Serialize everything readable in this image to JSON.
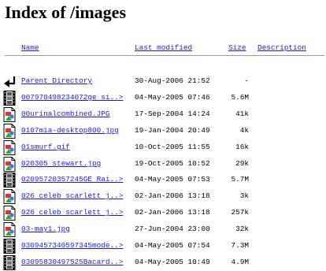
{
  "title": "Index of /images",
  "columns": {
    "name": "Name",
    "last_modified": "Last modified",
    "size": "Size",
    "description": "Description"
  },
  "entries": [
    {
      "name": "Parent Directory",
      "modified": "30-Aug-2006 21:52",
      "size": "-",
      "icon": "back-arrow-icon"
    },
    {
      "name": "007970498234072ge si..>",
      "modified": "04-May-2005 07:46",
      "size": "5.6M",
      "icon": "movie-file-icon"
    },
    {
      "name": "00urinalcombined.JPG",
      "modified": "17-Sep-2004 14:24",
      "size": "41k",
      "icon": "image-file-icon"
    },
    {
      "name": "0107mia-desktop800.jpg",
      "modified": "19-Jan-2004 20:49",
      "size": "4k",
      "icon": "image-file-icon"
    },
    {
      "name": "01smurf.gif",
      "modified": "10-Oct-2005 11:55",
      "size": "16k",
      "icon": "image-file-icon"
    },
    {
      "name": "020305 stewart.jpg",
      "modified": "19-Oct-2005 10:52",
      "size": "29k",
      "icon": "image-file-icon"
    },
    {
      "name": "02095720357245GE Rai..>",
      "modified": "04-May-2005 07:53",
      "size": "5.7M",
      "icon": "movie-file-icon"
    },
    {
      "name": "026 celeb scarlett j..>",
      "modified": "02-Jan-2006 13:18",
      "size": "3k",
      "icon": "image-file-icon"
    },
    {
      "name": "026 celeb scarlett j..>",
      "modified": "02-Jan-2006 13:18",
      "size": "257k",
      "icon": "image-file-icon"
    },
    {
      "name": "03-may1.jpg",
      "modified": "27-Jun-2004 23:00",
      "size": "32k",
      "icon": "image-file-icon"
    },
    {
      "name": "0309457340597345mode..>",
      "modified": "04-May-2005 07:54",
      "size": "7.3M",
      "icon": "movie-file-icon"
    },
    {
      "name": "03095830497525Bacard..>",
      "modified": "04-May-2005 10:49",
      "size": "4.9M",
      "icon": "movie-file-icon"
    }
  ]
}
